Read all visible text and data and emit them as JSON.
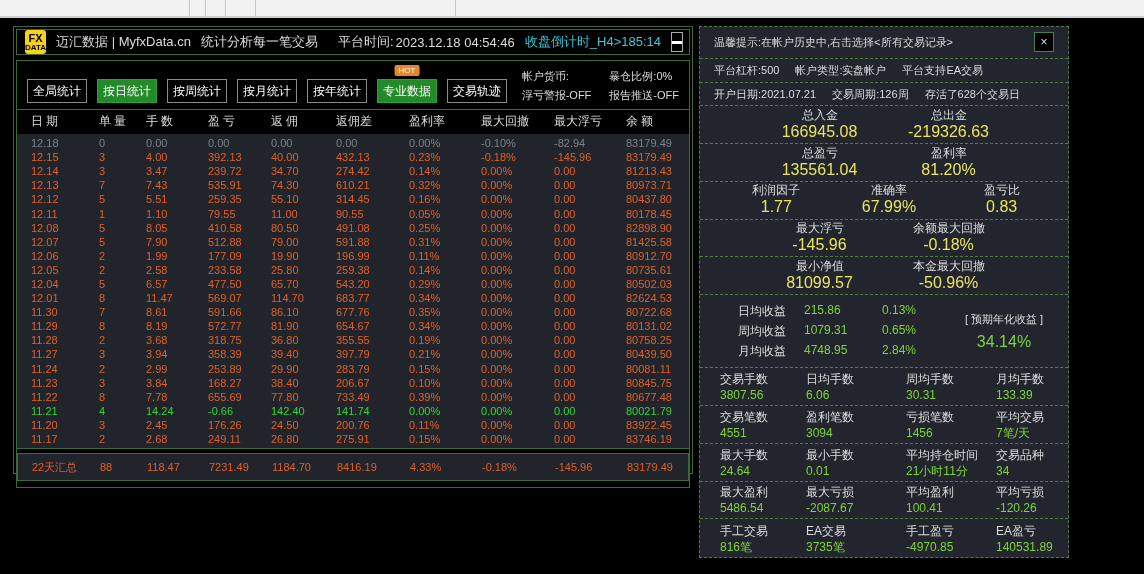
{
  "header": {
    "logo_top": "FX",
    "logo_bottom": "DATA",
    "title": "迈汇数据 | MyfxData.cn",
    "subtitle": "统计分析每一笔交易",
    "time_label": "平台时间:",
    "time": "2023.12.18 04:54:46",
    "countdown": "收盘倒计时_H4>185:14"
  },
  "tabs": [
    {
      "label": "全局统计",
      "selected": false
    },
    {
      "label": "按日统计",
      "selected": true
    },
    {
      "label": "按周统计",
      "selected": false
    },
    {
      "label": "按月统计",
      "selected": false
    },
    {
      "label": "按年统计",
      "selected": false
    },
    {
      "label": "专业数据",
      "selected": true,
      "badge": "HOT"
    },
    {
      "label": "交易轨迹",
      "selected": false
    }
  ],
  "account_flags": [
    "帐户货币:",
    "暴仓比例:0%",
    "浮亏警报-OFF",
    "报告推送-OFF"
  ],
  "table": {
    "columns": [
      "日 期",
      "单 量",
      "手 数",
      "盈 亏",
      "返 佣",
      "返佣差",
      "盈利率",
      "最大回撤",
      "最大浮亏",
      "余 额"
    ],
    "rows": [
      {
        "color": "#7d8189",
        "cells": [
          "12.18",
          "0",
          "0.00",
          "0.00",
          "0.00",
          "0.00",
          "0.00%",
          "-0.10%",
          "-82.94",
          "83179.49"
        ]
      },
      {
        "color": "#e0602a",
        "cells": [
          "12.15",
          "3",
          "4.00",
          "392.13",
          "40.00",
          "432.13",
          "0.23%",
          "-0.18%",
          "-145.96",
          "83179.49"
        ]
      },
      {
        "color": "#e0602a",
        "cells": [
          "12.14",
          "3",
          "3.47",
          "239.72",
          "34.70",
          "274.42",
          "0.14%",
          "0.00%",
          "0.00",
          "81213.43"
        ]
      },
      {
        "color": "#e0602a",
        "cells": [
          "12.13",
          "7",
          "7.43",
          "535.91",
          "74.30",
          "610.21",
          "0.32%",
          "0.00%",
          "0.00",
          "80973.71"
        ]
      },
      {
        "color": "#e0602a",
        "cells": [
          "12.12",
          "5",
          "5.51",
          "259.35",
          "55.10",
          "314.45",
          "0.16%",
          "0.00%",
          "0.00",
          "80437.80"
        ]
      },
      {
        "color": "#e0602a",
        "cells": [
          "12.11",
          "1",
          "1.10",
          "79.55",
          "11.00",
          "90.55",
          "0.05%",
          "0.00%",
          "0.00",
          "80178.45"
        ]
      },
      {
        "color": "#e0602a",
        "cells": [
          "12.08",
          "5",
          "8.05",
          "410.58",
          "80.50",
          "491.08",
          "0.25%",
          "0.00%",
          "0.00",
          "82898.90"
        ]
      },
      {
        "color": "#e0602a",
        "cells": [
          "12.07",
          "5",
          "7.90",
          "512.88",
          "79.00",
          "591.88",
          "0.31%",
          "0.00%",
          "0.00",
          "81425.58"
        ]
      },
      {
        "color": "#e0602a",
        "cells": [
          "12.06",
          "2",
          "1.99",
          "177.09",
          "19.90",
          "196.99",
          "0.11%",
          "0.00%",
          "0.00",
          "80912.70"
        ]
      },
      {
        "color": "#e0602a",
        "cells": [
          "12.05",
          "2",
          "2.58",
          "233.58",
          "25.80",
          "259.38",
          "0.14%",
          "0.00%",
          "0.00",
          "80735.61"
        ]
      },
      {
        "color": "#e0602a",
        "cells": [
          "12.04",
          "5",
          "6.57",
          "477.50",
          "65.70",
          "543.20",
          "0.29%",
          "0.00%",
          "0.00",
          "80502.03"
        ]
      },
      {
        "color": "#e0602a",
        "cells": [
          "12.01",
          "8",
          "11.47",
          "569.07",
          "114.70",
          "683.77",
          "0.34%",
          "0.00%",
          "0.00",
          "82624.53"
        ]
      },
      {
        "color": "#e0602a",
        "cells": [
          "11.30",
          "7",
          "8.61",
          "591.66",
          "86.10",
          "677.76",
          "0.35%",
          "0.00%",
          "0.00",
          "80722.68"
        ]
      },
      {
        "color": "#e0602a",
        "cells": [
          "11.29",
          "8",
          "8.19",
          "572.77",
          "81.90",
          "654.67",
          "0.34%",
          "0.00%",
          "0.00",
          "80131.02"
        ]
      },
      {
        "color": "#e0602a",
        "cells": [
          "11.28",
          "2",
          "3.68",
          "318.75",
          "36.80",
          "355.55",
          "0.19%",
          "0.00%",
          "0.00",
          "80758.25"
        ]
      },
      {
        "color": "#e0602a",
        "cells": [
          "11.27",
          "3",
          "3.94",
          "358.39",
          "39.40",
          "397.79",
          "0.21%",
          "0.00%",
          "0.00",
          "80439.50"
        ]
      },
      {
        "color": "#e0602a",
        "cells": [
          "11.24",
          "2",
          "2.99",
          "253.89",
          "29.90",
          "283.79",
          "0.15%",
          "0.00%",
          "0.00",
          "80081.11"
        ]
      },
      {
        "color": "#e0602a",
        "cells": [
          "11.23",
          "3",
          "3.84",
          "168.27",
          "38.40",
          "206.67",
          "0.10%",
          "0.00%",
          "0.00",
          "80845.75"
        ]
      },
      {
        "color": "#e0602a",
        "cells": [
          "11.22",
          "8",
          "7.78",
          "655.69",
          "77.80",
          "733.49",
          "0.39%",
          "0.00%",
          "0.00",
          "80677.48"
        ]
      },
      {
        "color": "#33d633",
        "cells": [
          "11.21",
          "4",
          "14.24",
          "-0.66",
          "142.40",
          "141.74",
          "0.00%",
          "0.00%",
          "0.00",
          "80021.79"
        ]
      },
      {
        "color": "#e0602a",
        "cells": [
          "11.20",
          "3",
          "2.45",
          "176.26",
          "24.50",
          "200.76",
          "0.11%",
          "0.00%",
          "0.00",
          "83922.45"
        ]
      },
      {
        "color": "#e0602a",
        "cells": [
          "11.17",
          "2",
          "2.68",
          "249.11",
          "26.80",
          "275.91",
          "0.15%",
          "0.00%",
          "0.00",
          "83746.19"
        ]
      }
    ],
    "summary": [
      "22天汇总",
      "88",
      "118.47",
      "7231.49",
      "1184.70",
      "8416.19",
      "4.33%",
      "-0.18%",
      "-145.96",
      "83179.49"
    ]
  },
  "side": {
    "notice": "温馨提示:在帐户历史中,右击选择<所有交易记录>",
    "close": "×",
    "info_lines": [
      [
        "平台杠杆:500",
        "帐户类型:实盘帐户",
        "平台支持EA交易"
      ],
      [
        "开户日期:2021.07.21",
        "交易周期:126周",
        "存活了628个交易日"
      ]
    ],
    "big_stats": [
      [
        {
          "label": "总入金",
          "value": "166945.08"
        },
        {
          "label": "总出金",
          "value": "-219326.63"
        }
      ],
      [
        {
          "label": "总盈亏",
          "value": "135561.04"
        },
        {
          "label": "盈利率",
          "value": "81.20%"
        }
      ],
      [
        {
          "label": "利润因子",
          "value": "1.77"
        },
        {
          "label": "准确率",
          "value": "67.99%"
        },
        {
          "label": "盈亏比",
          "value": "0.83"
        }
      ],
      [
        {
          "label": "最大浮亏",
          "value": "-145.96"
        },
        {
          "label": "余额最大回撤",
          "value": "-0.18%"
        }
      ],
      [
        {
          "label": "最小净值",
          "value": "81099.57"
        },
        {
          "label": "本金最大回撤",
          "value": "-50.96%"
        }
      ]
    ],
    "averages": [
      {
        "label": "日均收益",
        "value": "215.86",
        "percent": "0.13%"
      },
      {
        "label": "周均收益",
        "value": "1079.31",
        "percent": "0.65%"
      },
      {
        "label": "月均收益",
        "value": "4748.95",
        "percent": "2.84%"
      }
    ],
    "annual": {
      "label": "[ 预期年化收益 ]",
      "value": "34.14%"
    },
    "grid": [
      [
        {
          "label": "交易手数",
          "value": "3807.56"
        },
        {
          "label": "日均手数",
          "value": "6.06"
        },
        {
          "label": "周均手数",
          "value": "30.31"
        },
        {
          "label": "月均手数",
          "value": "133.39"
        }
      ],
      [
        {
          "label": "交易笔数",
          "value": "4551"
        },
        {
          "label": "盈利笔数",
          "value": "3094"
        },
        {
          "label": "亏损笔数",
          "value": "1456"
        },
        {
          "label": "平均交易",
          "value": "7笔/天"
        }
      ],
      [
        {
          "label": "最大手数",
          "value": "24.64"
        },
        {
          "label": "最小手数",
          "value": "0.01"
        },
        {
          "label": "平均持仓时间",
          "value": "21小时11分"
        },
        {
          "label": "交易品种",
          "value": "34"
        }
      ],
      [
        {
          "label": "最大盈利",
          "value": "5486.54"
        },
        {
          "label": "最大亏损",
          "value": "-2087.67"
        },
        {
          "label": "平均盈利",
          "value": "100.41"
        },
        {
          "label": "平均亏损",
          "value": "-120.26"
        }
      ],
      [
        {
          "label": "手工交易",
          "value": "816笔"
        },
        {
          "label": "EA交易",
          "value": "3735笔"
        },
        {
          "label": "手工盈亏",
          "value": "-4970.85"
        },
        {
          "label": "EA盈亏",
          "value": "140531.89"
        }
      ]
    ]
  }
}
